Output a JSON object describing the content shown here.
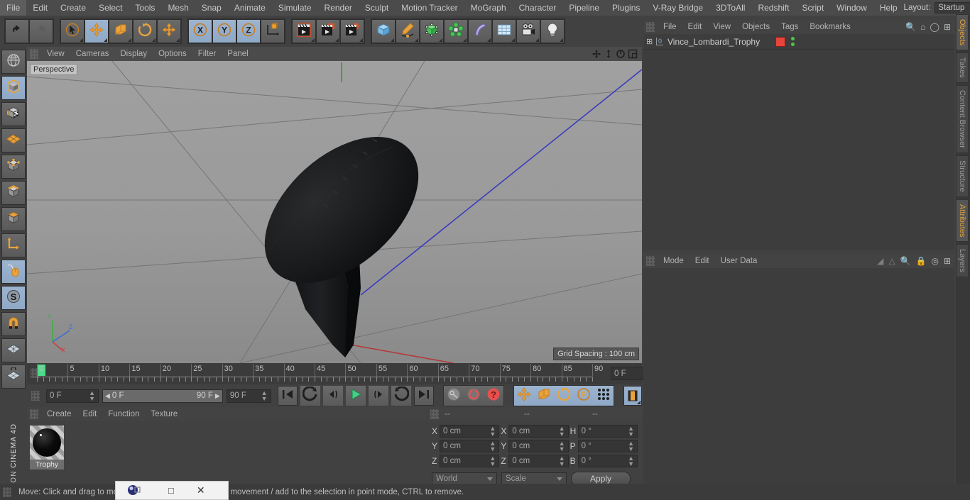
{
  "app": {
    "title": "CINEMA 4D",
    "brand": "MAXON"
  },
  "menubar": {
    "items": [
      "File",
      "Edit",
      "Create",
      "Select",
      "Tools",
      "Mesh",
      "Snap",
      "Animate",
      "Simulate",
      "Render",
      "Sculpt",
      "Motion Tracker",
      "MoGraph",
      "Character",
      "Pipeline",
      "Plugins",
      "V-Ray Bridge",
      "3DToAll",
      "Redshift",
      "Script",
      "Window",
      "Help"
    ],
    "layout_label": "Layout:",
    "layout_value": "Startup",
    "search_icon": "search-icon"
  },
  "main_toolbar": {
    "groups": [
      {
        "name": "history",
        "buttons": [
          {
            "name": "undo-button",
            "icon": "undo-arrow-icon",
            "active": false
          },
          {
            "name": "redo-button",
            "icon": "redo-arrow-icon",
            "active": false,
            "disabled": true
          }
        ]
      },
      {
        "name": "selection-tools",
        "buttons": [
          {
            "name": "live-selection-button",
            "icon": "cursor-circle-icon",
            "active": false
          },
          {
            "name": "move-tool-button",
            "icon": "move-arrows-icon",
            "active": true
          },
          {
            "name": "scale-tool-button",
            "icon": "scale-box-icon",
            "active": false
          },
          {
            "name": "rotate-tool-button",
            "icon": "rotate-arc-icon",
            "active": false
          },
          {
            "name": "move-duplicate-button",
            "icon": "move-arrows-icon",
            "active": false
          }
        ]
      },
      {
        "name": "axis-locks",
        "buttons": [
          {
            "name": "lock-x-button",
            "icon": "x-axis-icon",
            "label": "X",
            "active": true
          },
          {
            "name": "lock-y-button",
            "icon": "y-axis-icon",
            "label": "Y",
            "active": true
          },
          {
            "name": "lock-z-button",
            "icon": "z-axis-icon",
            "label": "Z",
            "active": true
          },
          {
            "name": "world-object-coord-button",
            "icon": "world-axis-cube-icon",
            "active": false
          }
        ]
      },
      {
        "name": "render",
        "buttons": [
          {
            "name": "render-view-button",
            "icon": "clapboard-icon",
            "active": false
          },
          {
            "name": "render-to-picture-viewer-button",
            "icon": "clapboard-window-icon",
            "active": false
          },
          {
            "name": "render-settings-button",
            "icon": "clapboard-gear-icon",
            "active": false
          }
        ]
      },
      {
        "name": "create",
        "buttons": [
          {
            "name": "add-cube-button",
            "icon": "blue-cube-icon",
            "active": false
          },
          {
            "name": "add-spline-button",
            "icon": "pen-spline-icon",
            "active": false
          },
          {
            "name": "add-nurbs-button",
            "icon": "green-cube-icon",
            "active": false
          },
          {
            "name": "add-array-button",
            "icon": "green-cluster-icon",
            "active": false
          },
          {
            "name": "add-deformer-button",
            "icon": "bend-deformer-icon",
            "active": false
          },
          {
            "name": "add-environment-button",
            "icon": "floor-grid-icon",
            "active": false
          },
          {
            "name": "add-camera-button",
            "icon": "camera-icon",
            "active": false
          },
          {
            "name": "add-light-button",
            "icon": "lightbulb-icon",
            "active": false
          }
        ]
      }
    ]
  },
  "left_toolbar": {
    "buttons": [
      {
        "name": "make-editable-button",
        "icon": "globe-wire-icon",
        "active": false
      },
      {
        "name": "model-mode-button",
        "icon": "model-cube-icon",
        "active": true
      },
      {
        "name": "texture-mode-button",
        "icon": "checker-cube-icon",
        "active": false
      },
      {
        "name": "workplane-button",
        "icon": "orange-grid-plane-icon",
        "active": false
      },
      {
        "name": "point-mode-button",
        "icon": "points-cube-icon",
        "active": false
      },
      {
        "name": "edge-mode-button",
        "icon": "edges-cube-icon",
        "active": false
      },
      {
        "name": "polygon-mode-button",
        "icon": "polygon-cube-icon",
        "active": false
      },
      {
        "name": "axis-modify-button",
        "icon": "axis-l-icon",
        "active": false
      },
      {
        "name": "viewport-solo-button",
        "icon": "mouse-icon",
        "active": true
      },
      {
        "name": "snap-button",
        "icon": "snap-s-icon",
        "active": true
      },
      {
        "name": "magnet-button",
        "icon": "magnet-icon",
        "active": false
      },
      {
        "name": "workplane-grid-button",
        "icon": "grid-plane-icon",
        "active": false
      },
      {
        "name": "workplane-lock-button",
        "icon": "grid-lock-icon",
        "active": false
      }
    ]
  },
  "viewport": {
    "menu": [
      "View",
      "Cameras",
      "Display",
      "Options",
      "Filter",
      "Panel"
    ],
    "nav_icons": [
      "pan-icon",
      "dolly-icon",
      "rotate-icon",
      "maximize-icon"
    ],
    "label": "Perspective",
    "grid_spacing": "Grid Spacing : 100 cm",
    "axis_gizmo": {
      "y": "Y",
      "z": "Z",
      "x": "X"
    },
    "bg_top": "#9b9b9b",
    "bg_bottom": "#8d8d8d",
    "model_color": "#17181a"
  },
  "timeline": {
    "ticks": [
      0,
      5,
      10,
      15,
      20,
      25,
      30,
      35,
      40,
      45,
      50,
      55,
      60,
      65,
      70,
      75,
      80,
      85,
      90
    ],
    "min": 0,
    "max": 90,
    "playhead_frame": 0,
    "playhead_color": "#4ddc8a",
    "current_frame_field": "0 F"
  },
  "transport": {
    "start_frame": "0 F",
    "range_start": "0 F",
    "range_end": "90 F",
    "end_frame": "90 F",
    "buttons": [
      {
        "name": "go-to-start-button",
        "icon": "skip-start-icon"
      },
      {
        "name": "go-to-previous-key-button",
        "icon": "prev-key-icon"
      },
      {
        "name": "step-back-button",
        "icon": "step-back-icon"
      },
      {
        "name": "play-button",
        "icon": "play-icon",
        "color": "#45d184"
      },
      {
        "name": "step-forward-button",
        "icon": "step-forward-icon"
      },
      {
        "name": "go-to-next-key-button",
        "icon": "next-key-icon"
      },
      {
        "name": "go-to-end-button",
        "icon": "skip-end-icon"
      }
    ],
    "key_buttons": [
      {
        "name": "record-active-objects-button",
        "icon": "key-icon",
        "color": "#8b8b8b"
      },
      {
        "name": "autokeying-button",
        "icon": "red-circle-icon",
        "color": "#e05a5a"
      },
      {
        "name": "keyframe-selection-button",
        "icon": "red-question-icon",
        "color": "#e05a5a"
      }
    ],
    "toggles": [
      {
        "name": "position-key-button",
        "icon": "move-arrows-icon",
        "active": true
      },
      {
        "name": "scale-key-button",
        "icon": "scale-box-icon",
        "active": true
      },
      {
        "name": "rotation-key-button",
        "icon": "rotate-arc-icon",
        "active": true
      },
      {
        "name": "parameter-key-button",
        "icon": "p-circle-icon",
        "active": true
      },
      {
        "name": "point-level-animation-button",
        "icon": "dots-grid-icon",
        "active": true
      }
    ],
    "filmstrip": {
      "name": "timeline-filmstrip-button",
      "icon": "filmstrip-icon",
      "active": true
    }
  },
  "material_manager": {
    "menu": [
      "Create",
      "Edit",
      "Function",
      "Texture"
    ],
    "materials": [
      {
        "name": "Trophy",
        "swatch_color": "#0b0b0b"
      }
    ]
  },
  "coordinates": {
    "headers": [
      "--",
      "--",
      "--"
    ],
    "rows": [
      {
        "labels": [
          "X",
          "X",
          "H"
        ],
        "values": [
          "0 cm",
          "0 cm",
          "0 °"
        ]
      },
      {
        "labels": [
          "Y",
          "Y",
          "P"
        ],
        "values": [
          "0 cm",
          "0 cm",
          "0 °"
        ]
      },
      {
        "labels": [
          "Z",
          "Z",
          "B"
        ],
        "values": [
          "0 cm",
          "0 cm",
          "0 °"
        ]
      }
    ],
    "coord_system": "World",
    "size_mode": "Scale",
    "apply_label": "Apply"
  },
  "object_manager": {
    "menu": [
      "File",
      "Edit",
      "View",
      "Objects",
      "Tags",
      "Bookmarks"
    ],
    "header_icons": [
      "search-icon",
      "home-icon",
      "ellipse-icon",
      "plus-box-icon"
    ],
    "objects": [
      {
        "name": "Vince_Lombardi_Trophy",
        "layer_badge": "0",
        "tag_color": "#e8443b",
        "visible_dots": "#55c24a"
      }
    ]
  },
  "attribute_manager": {
    "menu": [
      "Mode",
      "Edit",
      "User Data"
    ],
    "header_icons": [
      "fan-icon",
      "triangle-icon",
      "search-icon",
      "lock-icon",
      "target-icon",
      "plus-box-icon"
    ]
  },
  "right_tabs": [
    {
      "label": "Objects",
      "active": true
    },
    {
      "label": "Takes",
      "active": false
    },
    {
      "label": "Content Browser",
      "active": false
    },
    {
      "label": "Structure",
      "active": false
    },
    {
      "label": "Attributes",
      "active": true
    },
    {
      "label": "Layers",
      "active": false
    }
  ],
  "status_bar": {
    "text_left": "Move: Click and drag to mo",
    "text_right": "FT to quantize movement / add to the selection in point mode, CTRL to remove."
  },
  "taskbar_window": {
    "icons": [
      "app-sphere-icon",
      "restore-icon",
      "maximize-icon",
      "close-icon"
    ]
  }
}
